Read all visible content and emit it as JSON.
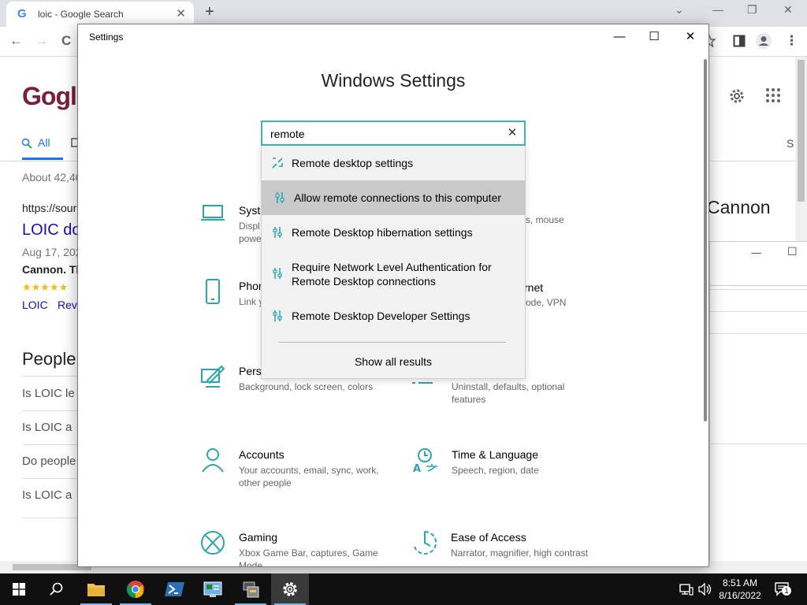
{
  "browser": {
    "tab_title": "loic - Google Search",
    "tab_favicon": "G",
    "close_tab": "✕",
    "new_tab": "+",
    "win_min": "⌄",
    "win_minimize": "—",
    "win_restore": "❐",
    "win_close": "✕",
    "back": "←",
    "forward": "→",
    "reload": "C",
    "menu": "⋮"
  },
  "google_page": {
    "logo_partial": "Gogl",
    "tab_all": "All",
    "result_count": "About 42,40",
    "result_url": "https://sour",
    "result_title": "LOIC do",
    "result_date": "Aug 17, 202",
    "result_snippet": "Cannon. Th",
    "stars": "★★★★★",
    "links_loic": "LOIC",
    "links_rev": "Rev",
    "people_heading": "People",
    "question_1": "Is LOIC le",
    "question_2": "Is LOIC a",
    "question_3": "Do people",
    "question_4": "Is LOIC a",
    "right_fragment": "Cannon",
    "right_s": "S"
  },
  "bg_window": {
    "minimize": "—",
    "maximize": "☐"
  },
  "settings": {
    "window_title": "Settings",
    "minimize": "—",
    "maximize": "☐",
    "close": "✕",
    "heading": "Windows Settings",
    "search": {
      "value": "remote",
      "clear": "✕"
    },
    "dropdown": {
      "items": [
        "Remote desktop settings",
        "Allow remote connections to this computer",
        "Remote Desktop hibernation settings",
        "Require Network Level Authentication for Remote Desktop connections",
        "Remote Desktop Developer Settings"
      ],
      "show_all": "Show all results"
    },
    "categories": {
      "system": {
        "name": "Syste",
        "desc": "Displ\npowe"
      },
      "devices_desc": "s, mouse",
      "phone": {
        "name": "Phon",
        "desc": "Link y"
      },
      "network": {
        "name": "rnet",
        "desc": "ode, VPN"
      },
      "personalization": {
        "name": "Perso",
        "desc": "Background, lock screen, colors"
      },
      "apps": {
        "name": "",
        "desc": "Uninstall, defaults, optional features"
      },
      "accounts": {
        "name": "Accounts",
        "desc": "Your accounts, email, sync, work, other people"
      },
      "time_language": {
        "name": "Time & Language",
        "desc": "Speech, region, date"
      },
      "gaming": {
        "name": "Gaming",
        "desc": "Xbox Game Bar, captures, Game Mode"
      },
      "ease_of_access": {
        "name": "Ease of Access",
        "desc": "Narrator, magnifier, high contrast"
      }
    }
  },
  "taskbar": {
    "time": "8:51 AM",
    "date": "8/16/2022",
    "notification_count": "1"
  },
  "colors": {
    "accent_teal": "#2aa8a8",
    "search_border": "#3fb6b0",
    "selected_row": "#c9c9c9"
  }
}
